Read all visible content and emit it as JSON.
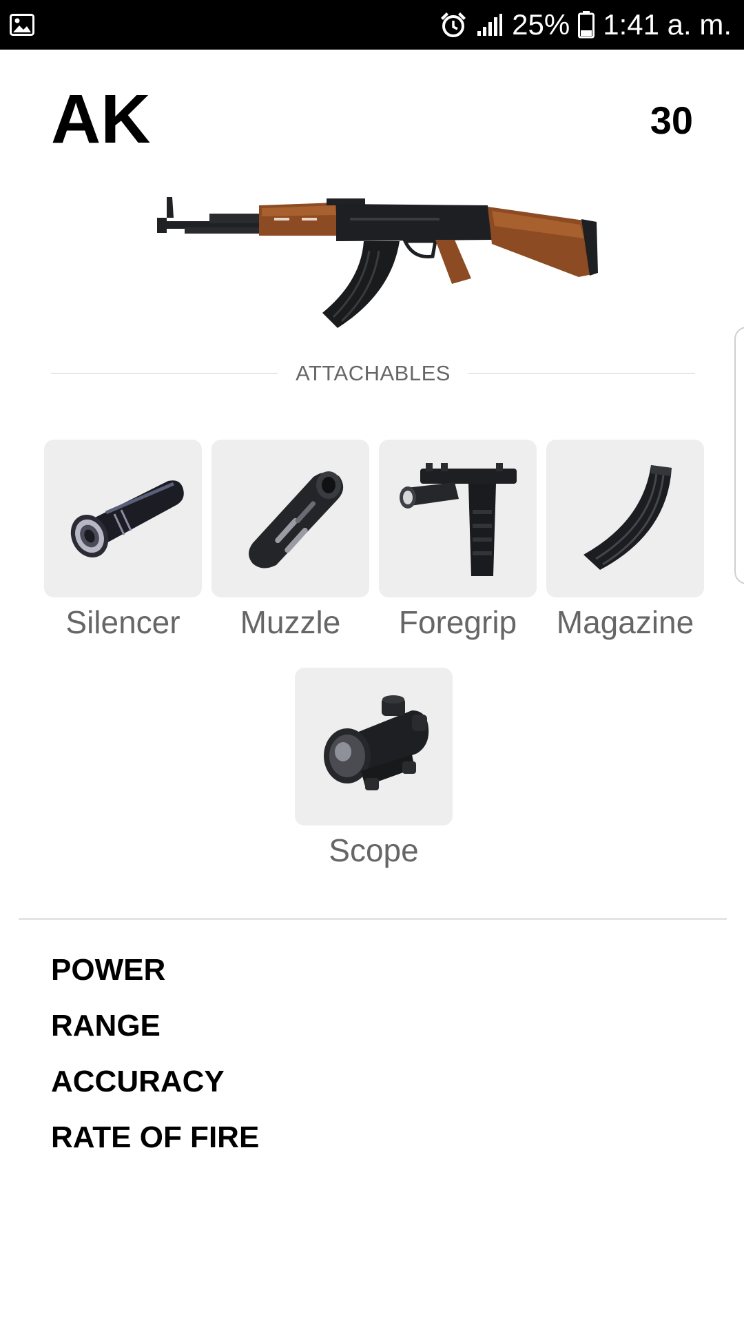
{
  "status_bar": {
    "battery": "25%",
    "time": "1:41 a. m.",
    "icons": [
      "gallery-icon",
      "alarm-icon",
      "signal-icon",
      "battery-icon"
    ]
  },
  "weapon": {
    "name": "AK",
    "ammo": "30",
    "image": "ak-rifle-image"
  },
  "attachables": {
    "heading": "ATTACHABLES",
    "items": [
      {
        "label": "Silencer",
        "icon": "silencer-icon"
      },
      {
        "label": "Muzzle",
        "icon": "muzzle-icon"
      },
      {
        "label": "Foregrip",
        "icon": "foregrip-icon"
      },
      {
        "label": "Magazine",
        "icon": "magazine-icon"
      },
      {
        "label": "Scope",
        "icon": "scope-icon"
      }
    ]
  },
  "stats": [
    "POWER",
    "RANGE",
    "ACCURACY",
    "RATE OF FIRE"
  ],
  "colors": {
    "status_bar": "#000000",
    "tile_background": "#eeeeee",
    "label_gray": "#666666",
    "wood": "#8b4a22",
    "metal": "#1e1f22"
  }
}
